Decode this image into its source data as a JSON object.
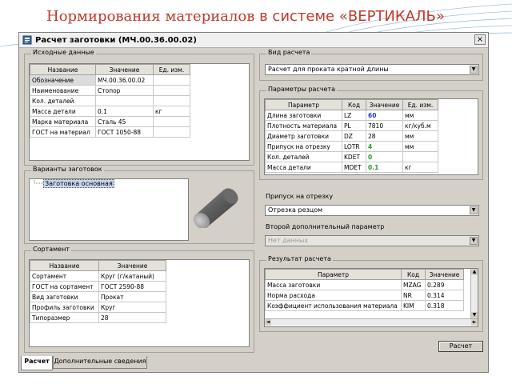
{
  "slide_title_main": "Нормирования материалов",
  "slide_title_rest": "в системе «ВЕРТИКАЛЬ»",
  "window": {
    "title": "Расчет заготовки (МЧ.00.36.00.02)",
    "close": "×"
  },
  "source": {
    "title": "Исходные данные",
    "columns": [
      "Название",
      "Значение",
      "Ед. изм."
    ],
    "rows": [
      [
        "Обозначение",
        "МЧ.00.36.00.02",
        ""
      ],
      [
        "Наименование",
        "Стопор",
        ""
      ],
      [
        "Кол. деталей",
        "",
        ""
      ],
      [
        "Масса детали",
        "0.1",
        "кг"
      ],
      [
        "Марка материала",
        "Сталь 45",
        ""
      ],
      [
        "ГОСТ на материал",
        "ГОСТ 1050-88",
        ""
      ]
    ]
  },
  "variants": {
    "title": "Варианты заготовок",
    "item": "Заготовка основная"
  },
  "sortament": {
    "title": "Сортамент",
    "columns": [
      "Название",
      "Значение"
    ],
    "rows": [
      [
        "Сортамент",
        "Круг (г/катаный)"
      ],
      [
        "ГОСТ на сортамент",
        "ГОСТ 2590-88"
      ],
      [
        "Вид заготовки",
        "Прокат"
      ],
      [
        "Профиль заготовки",
        "Круг"
      ],
      [
        "Типоразмер",
        "28"
      ]
    ]
  },
  "calc_type": {
    "title": "Вид расчета",
    "value": "Расчет для проката кратной длины"
  },
  "params": {
    "title": "Параметры расчета",
    "columns": [
      "Параметр",
      "Код",
      "Значение",
      "Ед. изм."
    ],
    "rows": [
      [
        "Длина заготовки",
        "LZ",
        "60",
        "мм"
      ],
      [
        "Плотность материала",
        "PL",
        "7810",
        "кг/куб.м"
      ],
      [
        "Диаметр заготовки",
        "DZ",
        "28",
        "мм"
      ],
      [
        "Припуск на отрезку",
        "LOTR",
        "4",
        "мм"
      ],
      [
        "Кол. деталей",
        "KDET",
        "0",
        ""
      ],
      [
        "Масса детали",
        "MDET",
        "0.1",
        "кг"
      ]
    ]
  },
  "allowance": {
    "label": "Припуск на отрезку",
    "value": "Отрезка резцом"
  },
  "second_param": {
    "label": "Второй дополнительный параметр",
    "value": "Нет данных"
  },
  "result": {
    "title": "Результат расчета",
    "columns": [
      "Параметр",
      "Код",
      "Значение"
    ],
    "rows": [
      [
        "Масса заготовки",
        "MZAG",
        "0.289"
      ],
      [
        "Норма расхода",
        "NR",
        "0.314"
      ],
      [
        "Коэффициент использования материала",
        "KIM",
        "0.318"
      ]
    ]
  },
  "calc_button": "Расчет",
  "tabs": [
    "Расчет",
    "Дополнительные сведения"
  ],
  "colors": {
    "title_red": "#c0392b",
    "value_blue": "#1a3fc9",
    "value_green": "#1aa01a"
  }
}
